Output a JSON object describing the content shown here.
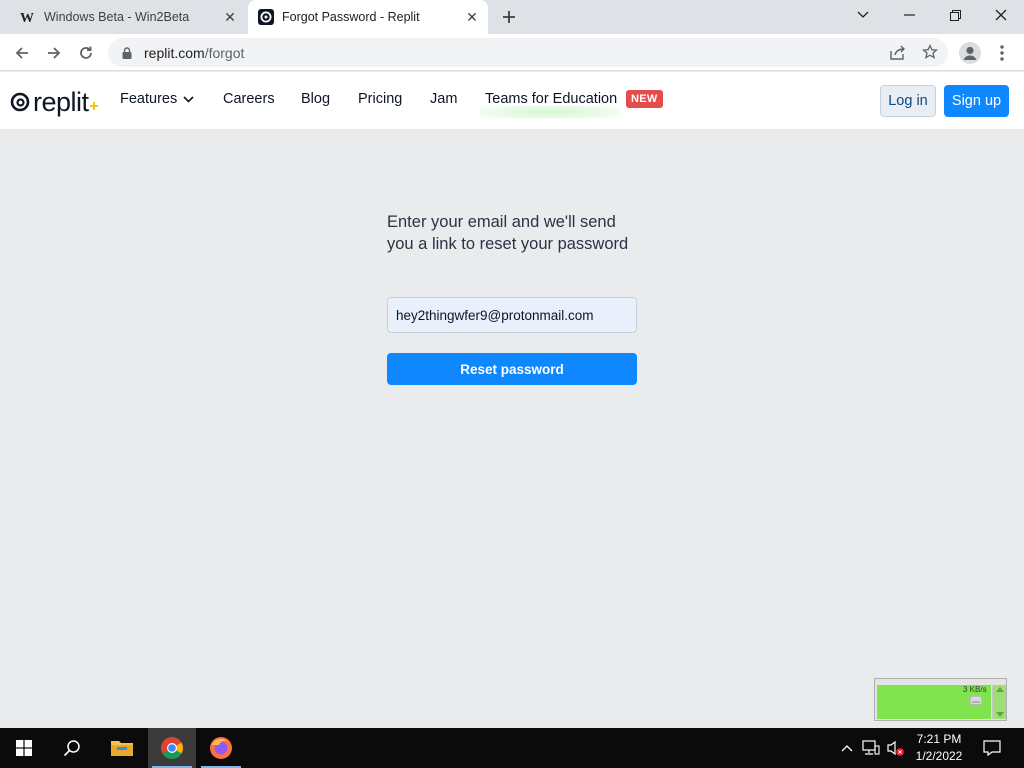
{
  "browser": {
    "tabs": [
      {
        "title": "Windows Beta - Win2Beta",
        "favicon": "win2beta-w-icon",
        "active": false
      },
      {
        "title": "Forgot Password - Replit",
        "favicon": "replit-icon",
        "active": true
      }
    ],
    "url_host": "replit.com",
    "url_path": "/forgot"
  },
  "header": {
    "logo_text": "replit",
    "nav": {
      "features": "Features",
      "careers": "Careers",
      "blog": "Blog",
      "pricing": "Pricing",
      "jam": "Jam",
      "teams": "Teams for Education"
    },
    "new_badge": "NEW",
    "login": "Log in",
    "signup": "Sign up"
  },
  "form": {
    "heading": "Enter your email and we'll send you a link to reset your password",
    "email_value": "hey2thingwfer9@protonmail.com",
    "submit": "Reset password"
  },
  "netmeter": {
    "rate": "3 KB/s"
  },
  "taskbar": {
    "time": "7:21 PM",
    "date": "1/2/2022"
  },
  "colors": {
    "brand_blue": "#0f87ff",
    "badge_red": "#e64c4c",
    "page_bg": "#eaebed"
  }
}
